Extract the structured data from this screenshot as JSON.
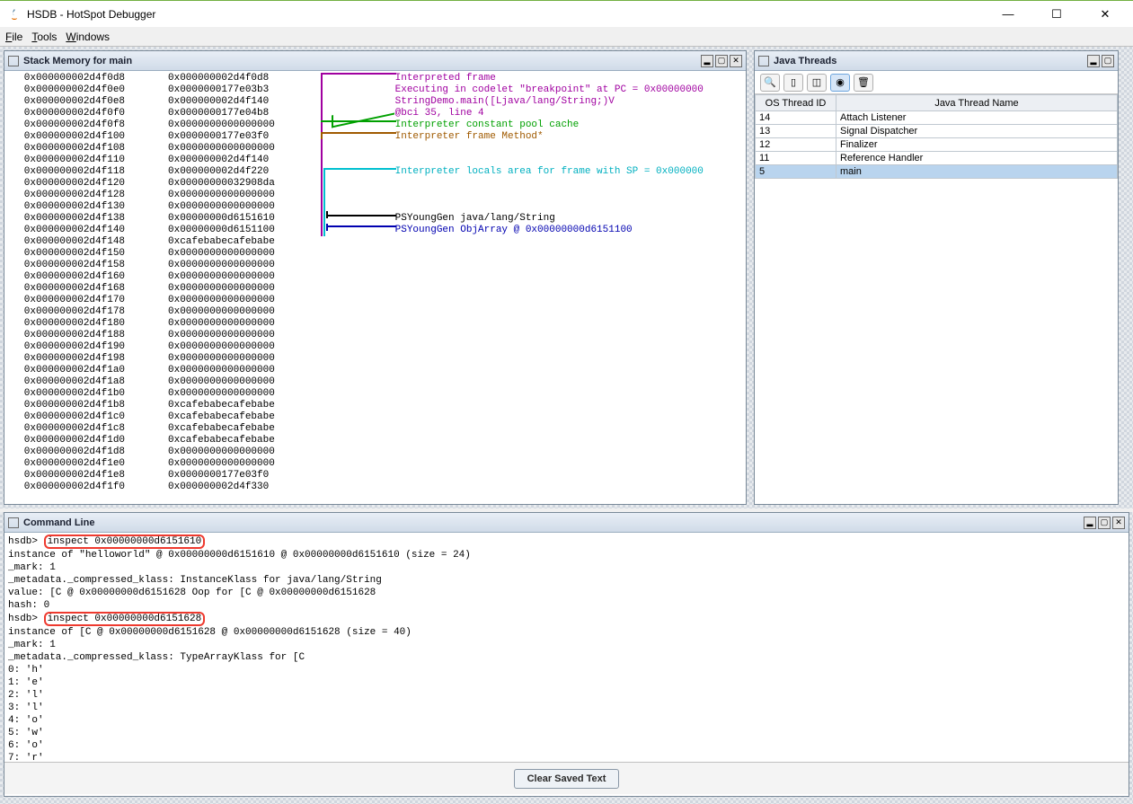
{
  "window": {
    "title": "HSDB - HotSpot Debugger"
  },
  "menu": {
    "file": "File",
    "tools": "Tools",
    "windows": "Windows"
  },
  "stack_frame": {
    "title": "Stack Memory for main",
    "rows": [
      {
        "a": "0x000000002d4f0d8",
        "v": "0x000000002d4f0d8",
        "d": "Interpreted frame",
        "c": "c-purple"
      },
      {
        "a": "0x000000002d4f0e0",
        "v": "0x0000000177e03b3",
        "d": "Executing in codelet \"breakpoint\" at PC = 0x00000000",
        "c": "c-purple"
      },
      {
        "a": "0x000000002d4f0e8",
        "v": "0x000000002d4f140",
        "d": "StringDemo.main([Ljava/lang/String;)V",
        "c": "c-purple"
      },
      {
        "a": "0x000000002d4f0f0",
        "v": "0x0000000177e04b8",
        "d": "@bci 35, line 4",
        "c": "c-purple"
      },
      {
        "a": "0x000000002d4f0f8",
        "v": "0x0000000000000000",
        "d": "Interpreter constant pool cache",
        "c": "c-green"
      },
      {
        "a": "0x000000002d4f100",
        "v": "0x0000000177e03f0",
        "d": "Interpreter frame Method*",
        "c": "c-brown"
      },
      {
        "a": "0x000000002d4f108",
        "v": "0x0000000000000000",
        "d": "",
        "c": ""
      },
      {
        "a": "0x000000002d4f110",
        "v": "0x000000002d4f140",
        "d": "",
        "c": ""
      },
      {
        "a": "0x000000002d4f118",
        "v": "0x000000002d4f220",
        "d": "Interpreter locals area for frame with SP = 0x000000",
        "c": "c-cyan"
      },
      {
        "a": "0x000000002d4f120",
        "v": "0x00000000032908da",
        "d": "",
        "c": ""
      },
      {
        "a": "0x000000002d4f128",
        "v": "0x0000000000000000",
        "d": "",
        "c": ""
      },
      {
        "a": "0x000000002d4f130",
        "v": "0x0000000000000000",
        "d": "",
        "c": ""
      },
      {
        "a": "0x000000002d4f138",
        "v": "0x00000000d6151610",
        "d": "PSYoungGen java/lang/String",
        "c": "c-black2"
      },
      {
        "a": "0x000000002d4f140",
        "v": "0x00000000d6151100",
        "d": "PSYoungGen ObjArray @ 0x00000000d6151100",
        "c": "c-navy"
      },
      {
        "a": "0x000000002d4f148",
        "v": "0xcafebabecafebabe",
        "d": "",
        "c": ""
      },
      {
        "a": "0x000000002d4f150",
        "v": "0x0000000000000000",
        "d": "",
        "c": ""
      },
      {
        "a": "0x000000002d4f158",
        "v": "0x0000000000000000",
        "d": "",
        "c": ""
      },
      {
        "a": "0x000000002d4f160",
        "v": "0x0000000000000000",
        "d": "",
        "c": ""
      },
      {
        "a": "0x000000002d4f168",
        "v": "0x0000000000000000",
        "d": "",
        "c": ""
      },
      {
        "a": "0x000000002d4f170",
        "v": "0x0000000000000000",
        "d": "",
        "c": ""
      },
      {
        "a": "0x000000002d4f178",
        "v": "0x0000000000000000",
        "d": "",
        "c": ""
      },
      {
        "a": "0x000000002d4f180",
        "v": "0x0000000000000000",
        "d": "",
        "c": ""
      },
      {
        "a": "0x000000002d4f188",
        "v": "0x0000000000000000",
        "d": "",
        "c": ""
      },
      {
        "a": "0x000000002d4f190",
        "v": "0x0000000000000000",
        "d": "",
        "c": ""
      },
      {
        "a": "0x000000002d4f198",
        "v": "0x0000000000000000",
        "d": "",
        "c": ""
      },
      {
        "a": "0x000000002d4f1a0",
        "v": "0x0000000000000000",
        "d": "",
        "c": ""
      },
      {
        "a": "0x000000002d4f1a8",
        "v": "0x0000000000000000",
        "d": "",
        "c": ""
      },
      {
        "a": "0x000000002d4f1b0",
        "v": "0x0000000000000000",
        "d": "",
        "c": ""
      },
      {
        "a": "0x000000002d4f1b8",
        "v": "0xcafebabecafebabe",
        "d": "",
        "c": ""
      },
      {
        "a": "0x000000002d4f1c0",
        "v": "0xcafebabecafebabe",
        "d": "",
        "c": ""
      },
      {
        "a": "0x000000002d4f1c8",
        "v": "0xcafebabecafebabe",
        "d": "",
        "c": ""
      },
      {
        "a": "0x000000002d4f1d0",
        "v": "0xcafebabecafebabe",
        "d": "",
        "c": ""
      },
      {
        "a": "0x000000002d4f1d8",
        "v": "0x0000000000000000",
        "d": "",
        "c": ""
      },
      {
        "a": "0x000000002d4f1e0",
        "v": "0x0000000000000000",
        "d": "",
        "c": ""
      },
      {
        "a": "0x000000002d4f1e8",
        "v": "0x0000000177e03f0",
        "d": "",
        "c": ""
      },
      {
        "a": "0x000000002d4f1f0",
        "v": "0x000000002d4f330",
        "d": "",
        "c": ""
      }
    ]
  },
  "threads_frame": {
    "title": "Java Threads",
    "columns": [
      "OS Thread ID",
      "Java Thread Name"
    ],
    "rows": [
      {
        "id": "14",
        "name": "Attach Listener"
      },
      {
        "id": "13",
        "name": "Signal Dispatcher"
      },
      {
        "id": "12",
        "name": "Finalizer"
      },
      {
        "id": "11",
        "name": "Reference Handler"
      },
      {
        "id": "5",
        "name": "main"
      }
    ],
    "selected": 4
  },
  "command_frame": {
    "title": "Command Line",
    "lines": [
      {
        "pre": "hsdb> ",
        "hl": "inspect 0x00000000d6151610",
        "post": ""
      },
      {
        "pre": "instance of \"helloworld\" @ 0x00000000d6151610 @ 0x00000000d6151610 (size = 24)",
        "hl": "",
        "post": ""
      },
      {
        "pre": "_mark: 1",
        "hl": "",
        "post": ""
      },
      {
        "pre": "_metadata._compressed_klass: InstanceKlass for java/lang/String",
        "hl": "",
        "post": ""
      },
      {
        "pre": "value: [C @ 0x00000000d6151628 Oop for [C @ 0x00000000d6151628",
        "hl": "",
        "post": ""
      },
      {
        "pre": "hash: 0",
        "hl": "",
        "post": ""
      },
      {
        "pre": "hsdb> ",
        "hl": "inspect 0x00000000d6151628",
        "post": ""
      },
      {
        "pre": "instance of [C @ 0x00000000d6151628 @ 0x00000000d6151628 (size = 40)",
        "hl": "",
        "post": ""
      },
      {
        "pre": "_mark: 1",
        "hl": "",
        "post": ""
      },
      {
        "pre": "_metadata._compressed_klass: TypeArrayKlass for [C",
        "hl": "",
        "post": ""
      },
      {
        "pre": "0: 'h'",
        "hl": "",
        "post": ""
      },
      {
        "pre": "1: 'e'",
        "hl": "",
        "post": ""
      },
      {
        "pre": "2: 'l'",
        "hl": "",
        "post": ""
      },
      {
        "pre": "3: 'l'",
        "hl": "",
        "post": ""
      },
      {
        "pre": "4: 'o'",
        "hl": "",
        "post": ""
      },
      {
        "pre": "5: 'w'",
        "hl": "",
        "post": ""
      },
      {
        "pre": "6: 'o'",
        "hl": "",
        "post": ""
      },
      {
        "pre": "7: 'r'",
        "hl": "",
        "post": ""
      }
    ],
    "clear_label": "Clear Saved Text"
  }
}
